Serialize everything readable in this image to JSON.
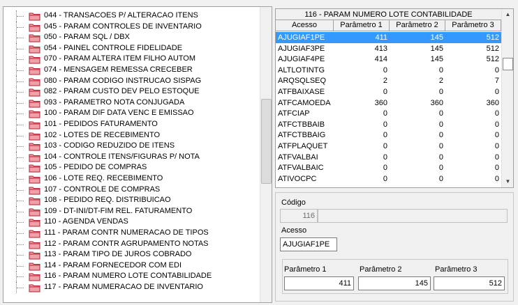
{
  "tree": {
    "items": [
      "044 - TRANSACOES P/ ALTERACAO ITENS",
      "045 - PARAM CONTROLES DE INVENTARIO",
      "050 - PARAM SQL / DBX",
      "054 - PAINEL CONTROLE FIDELIDADE",
      "070 - PARAM ALTERA ITEM FILHO AUTOM",
      "074 - MENSAGEM REMESSA CRECEBER",
      "080 - PARAM CODIGO INSTRUCAO SISPAG",
      "082 - PARAM CUSTO DEV PELO ESTOQUE",
      "093 - PARAMETRO NOTA CONJUGADA",
      "100 - PARAM DIF DATA VENC E EMISSAO",
      "101 - PEDIDOS FATURAMENTO",
      "102 - LOTES DE RECEBIMENTO",
      "103 - CODIGO REDUZIDO DE ITENS",
      "104 - CONTROLE ITENS/FIGURAS P/ NOTA",
      "105 - PEDIDO DE COMPRAS",
      "106 - LOTE REQ. RECEBIMENTO",
      "107 - CONTROLE DE COMPRAS",
      "108 - PEDIDO REQ. DISTRIBUICAO",
      "109 - DT-INI/DT-FIM REL. FATURAMENTO",
      "110 - AGENDA VENDAS",
      "111 - PARAM CONTR NUMERACAO DE TIPOS",
      "112 - PARAM CONTR AGRUPAMENTO NOTAS",
      "113 - PARAM TIPO DE JUROS COBRADO",
      "114 - PARAM FORNECEDOR COM EDI",
      "116 - PARAM NUMERO LOTE CONTABILIDADE",
      "117 - PARAM NUMERACAO DE INVENTARIO"
    ]
  },
  "grid": {
    "title": "116 - PARAM NUMERO LOTE CONTABILIDADE",
    "columns": [
      "Acesso",
      "Parâmetro 1",
      "Parâmetro 2",
      "Parâmetro 3"
    ],
    "selected_index": 0,
    "rows": [
      [
        "AJUGIAF1PE",
        "411",
        "145",
        "512"
      ],
      [
        "AJUGIAF3PE",
        "413",
        "145",
        "512"
      ],
      [
        "AJUGIAF4PE",
        "414",
        "145",
        "512"
      ],
      [
        "ALTLOTINTG",
        "0",
        "0",
        "0"
      ],
      [
        "ARQSQLSEQ",
        "2",
        "2",
        "7"
      ],
      [
        "ATFBAIXASE",
        "0",
        "0",
        "0"
      ],
      [
        "ATFCAMOEDA",
        "360",
        "360",
        "360"
      ],
      [
        "ATFCIAP",
        "0",
        "0",
        "0"
      ],
      [
        "ATFCTBBAIB",
        "0",
        "0",
        "0"
      ],
      [
        "ATFCTBBAIG",
        "0",
        "0",
        "0"
      ],
      [
        "ATFPLAQUET",
        "0",
        "0",
        "0"
      ],
      [
        "ATFVALBAI",
        "0",
        "0",
        "0"
      ],
      [
        "ATFVALBAIC",
        "0",
        "0",
        "0"
      ],
      [
        "ATIVOCPC",
        "0",
        "0",
        "0"
      ]
    ]
  },
  "form": {
    "codigo_label": "Código",
    "codigo_value": "116",
    "acesso_label": "Acesso",
    "acesso_value": "AJUGIAF1PE",
    "param1_label": "Parâmetro 1",
    "param1_value": "411",
    "param2_label": "Parâmetro 2",
    "param2_value": "145",
    "param3_label": "Parâmetro 3",
    "param3_value": "512"
  },
  "icons": {
    "folder": "folder-icon",
    "scroll_up": "scroll-up-arrow-icon",
    "scroll_down": "scroll-down-arrow-icon"
  },
  "colors": {
    "selection": "#3399ff",
    "folder_fill": "#f0a0a8",
    "folder_stroke": "#b02030"
  }
}
